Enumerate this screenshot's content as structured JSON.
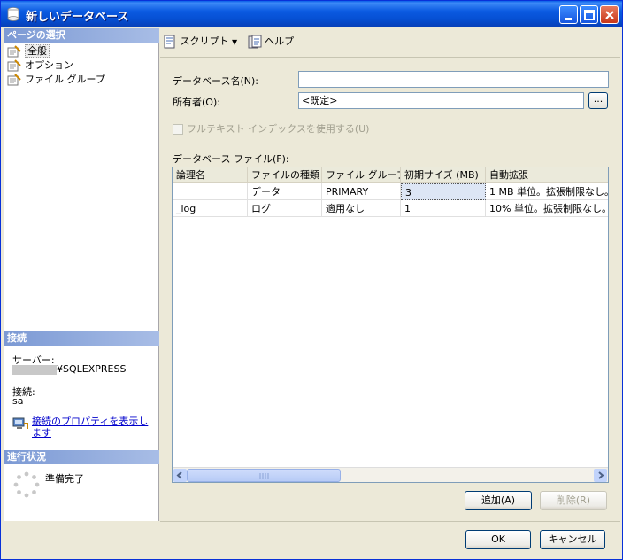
{
  "window": {
    "title": "新しいデータベース"
  },
  "left": {
    "select_page_header": "ページの選択",
    "pages": [
      "全般",
      "オプション",
      "ファイル グループ"
    ],
    "connection_header": "接続",
    "server_label": "サーバー:",
    "server_value": "¥SQLEXPRESS",
    "connection_label": "接続:",
    "connection_value": "sa",
    "view_props_link": "接続のプロパティを表示します",
    "progress_header": "進行状況",
    "progress_status": "準備完了"
  },
  "toolbar": {
    "script_label": "スクリプト",
    "help_label": "ヘルプ"
  },
  "form": {
    "db_name_label": "データベース名(N):",
    "db_name_value": "",
    "owner_label": "所有者(O):",
    "owner_value": "<既定>",
    "browse_label": "...",
    "fulltext_label": "フルテキスト インデックスを使用する(U)",
    "files_label": "データベース ファイル(F):"
  },
  "grid": {
    "headers": [
      "論理名",
      "ファイルの種類",
      "ファイル グループ",
      "初期サイズ (MB)",
      "自動拡張"
    ],
    "rows": [
      [
        "",
        "データ",
        "PRIMARY",
        "3",
        "1 MB 単位。拡張制限なし。"
      ],
      [
        "_log",
        "ログ",
        "適用なし",
        "1",
        "10% 単位。拡張制限なし。"
      ]
    ]
  },
  "buttons": {
    "add": "追加(A)",
    "remove": "削除(R)",
    "ok": "OK",
    "cancel": "キャンセル"
  }
}
